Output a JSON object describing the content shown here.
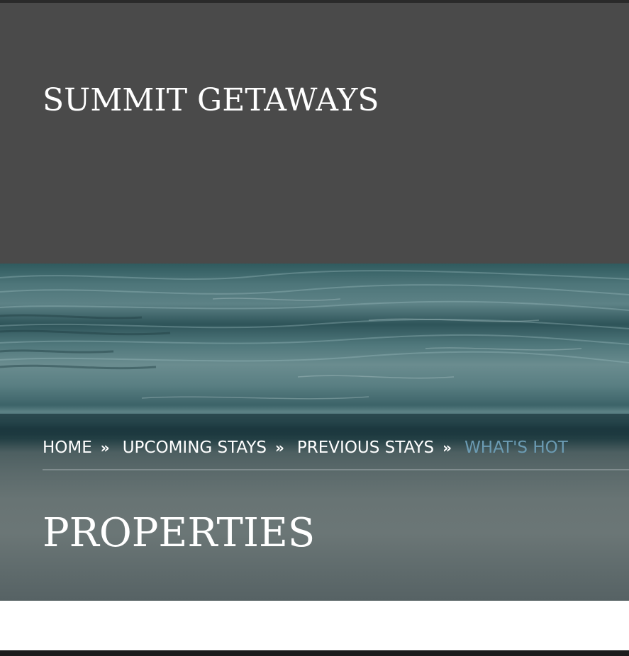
{
  "site": {
    "title": "SUMMIT GETAWAYS"
  },
  "breadcrumb": {
    "items": [
      {
        "label": "HOME"
      },
      {
        "label": "UPCOMING STAYS"
      },
      {
        "label": "PREVIOUS STAYS"
      },
      {
        "label": "WHAT'S HOT"
      }
    ],
    "separator": "»"
  },
  "page": {
    "title": "PROPERTIES"
  },
  "colors": {
    "header_bg": "#4a4a4a",
    "hero_tint": "#4d7579",
    "breadcrumb_current": "#6b9bb3",
    "text": "#ffffff"
  },
  "icons": {
    "breadcrumb_separator": "double-chevron-right-icon"
  }
}
